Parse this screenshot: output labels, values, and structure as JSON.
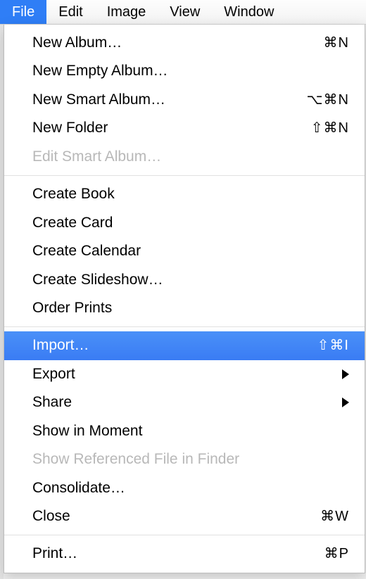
{
  "menubar": {
    "items": [
      {
        "label": "File",
        "active": true
      },
      {
        "label": "Edit",
        "active": false
      },
      {
        "label": "Image",
        "active": false
      },
      {
        "label": "View",
        "active": false
      },
      {
        "label": "Window",
        "active": false
      }
    ]
  },
  "dropdown": {
    "groups": [
      [
        {
          "label": "New Album…",
          "shortcut": "⌘N",
          "disabled": false,
          "highlighted": false,
          "submenu": false
        },
        {
          "label": "New Empty Album…",
          "shortcut": "",
          "disabled": false,
          "highlighted": false,
          "submenu": false
        },
        {
          "label": "New Smart Album…",
          "shortcut": "⌥⌘N",
          "disabled": false,
          "highlighted": false,
          "submenu": false
        },
        {
          "label": "New Folder",
          "shortcut": "⇧⌘N",
          "disabled": false,
          "highlighted": false,
          "submenu": false
        },
        {
          "label": "Edit Smart Album…",
          "shortcut": "",
          "disabled": true,
          "highlighted": false,
          "submenu": false
        }
      ],
      [
        {
          "label": "Create Book",
          "shortcut": "",
          "disabled": false,
          "highlighted": false,
          "submenu": false
        },
        {
          "label": "Create Card",
          "shortcut": "",
          "disabled": false,
          "highlighted": false,
          "submenu": false
        },
        {
          "label": "Create Calendar",
          "shortcut": "",
          "disabled": false,
          "highlighted": false,
          "submenu": false
        },
        {
          "label": "Create Slideshow…",
          "shortcut": "",
          "disabled": false,
          "highlighted": false,
          "submenu": false
        },
        {
          "label": "Order Prints",
          "shortcut": "",
          "disabled": false,
          "highlighted": false,
          "submenu": false
        }
      ],
      [
        {
          "label": "Import…",
          "shortcut": "⇧⌘I",
          "disabled": false,
          "highlighted": true,
          "submenu": false
        },
        {
          "label": "Export",
          "shortcut": "",
          "disabled": false,
          "highlighted": false,
          "submenu": true
        },
        {
          "label": "Share",
          "shortcut": "",
          "disabled": false,
          "highlighted": false,
          "submenu": true
        },
        {
          "label": "Show in Moment",
          "shortcut": "",
          "disabled": false,
          "highlighted": false,
          "submenu": false
        },
        {
          "label": "Show Referenced File in Finder",
          "shortcut": "",
          "disabled": true,
          "highlighted": false,
          "submenu": false
        },
        {
          "label": "Consolidate…",
          "shortcut": "",
          "disabled": false,
          "highlighted": false,
          "submenu": false
        },
        {
          "label": "Close",
          "shortcut": "⌘W",
          "disabled": false,
          "highlighted": false,
          "submenu": false
        }
      ],
      [
        {
          "label": "Print…",
          "shortcut": "⌘P",
          "disabled": false,
          "highlighted": false,
          "submenu": false
        }
      ]
    ]
  }
}
